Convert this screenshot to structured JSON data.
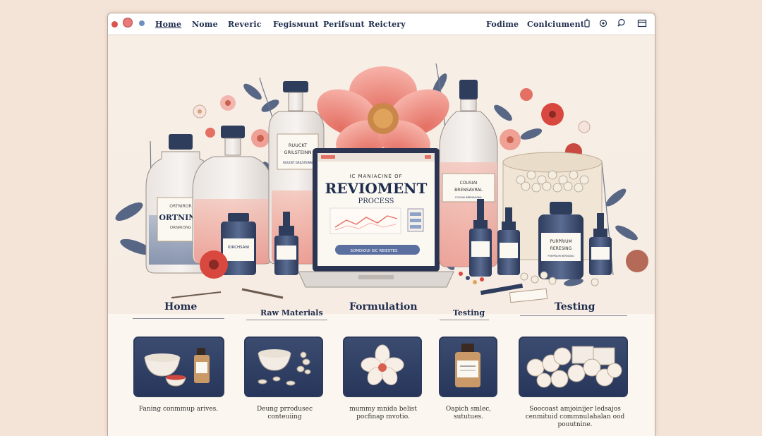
{
  "window": {
    "nav": [
      "Home",
      "Nome",
      "Reveric",
      "Fegisмunt",
      "Perifsunt",
      "Reictery"
    ],
    "nav_right": [
      "Fodime",
      "Conlciument"
    ],
    "icons": [
      "bookmark-icon",
      "settings-icon",
      "chat-icon",
      "window-icon"
    ]
  },
  "hero": {
    "bottle1_label": "ORTNING",
    "bottle1_sub": "ORTNIROR ORNRIONG",
    "bottle2_label": "RUUCKT GRILSTEINN",
    "bottle3_label": "IORCHSANI",
    "bottle4_label": "COUSIAI BRENSAVRAL",
    "bottle4_sub": "COSUSUI AUTNETIENTIONS",
    "bottle5_label": "PURPRIUM RERESING",
    "laptop": {
      "kicker": "IC MANIACINE OF",
      "title": "REVIOMENT",
      "subtitle": "PROCESS",
      "button": "SOMDIOUI SIC REIESTES"
    }
  },
  "sections": [
    {
      "title": "Home",
      "caption": "Faning conmmup arives."
    },
    {
      "title": "Raw Materials",
      "caption": "Deung prrodusec conteuiing"
    },
    {
      "title": "Formulation",
      "caption": "mummy mnida belist pocfinap mvotio."
    },
    {
      "title": "Testing",
      "caption": "Oapich smlec, sututues."
    },
    {
      "title": "Testing",
      "caption": "Soocoast amjoinijer ledsajos cenmituid commnulahalan ood pouutnine."
    }
  ],
  "colors": {
    "navy": "#1f2d4d",
    "coral": "#f08f84",
    "cream": "#fbf6ef",
    "background": "#f4e3d7"
  }
}
